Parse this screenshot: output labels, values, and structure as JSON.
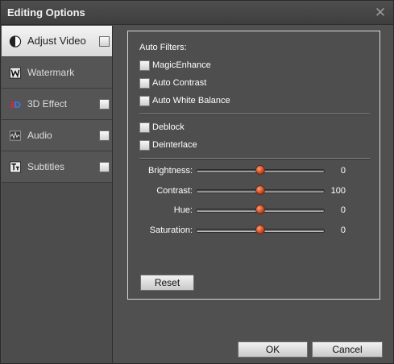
{
  "window": {
    "title": "Editing Options",
    "close_glyph": "✕"
  },
  "sidebar": {
    "items": [
      {
        "label": "Adjust Video",
        "icon": "adjust-video-icon",
        "active": true
      },
      {
        "label": "Watermark",
        "icon": "watermark-icon",
        "active": false
      },
      {
        "label": "3D Effect",
        "icon": "3d-effect-icon",
        "active": false
      },
      {
        "label": "Audio",
        "icon": "audio-icon",
        "active": false
      },
      {
        "label": "Subtitles",
        "icon": "subtitles-icon",
        "active": false
      }
    ]
  },
  "panel": {
    "auto_filters_label": "Auto Filters:",
    "filters": [
      {
        "label": "MagicEnhance",
        "checked": false
      },
      {
        "label": "Auto Contrast",
        "checked": false
      },
      {
        "label": "Auto White Balance",
        "checked": false
      }
    ],
    "processing": [
      {
        "label": "Deblock",
        "checked": false
      },
      {
        "label": "Deinterlace",
        "checked": false
      }
    ],
    "sliders": [
      {
        "label": "Brightness:",
        "value": "0",
        "level": 0.5
      },
      {
        "label": "Contrast:",
        "value": "100",
        "level": 0.5
      },
      {
        "label": "Hue:",
        "value": "0",
        "level": 0.5
      },
      {
        "label": "Saturation:",
        "value": "0",
        "level": 0.5
      }
    ],
    "reset_label": "Reset"
  },
  "footer": {
    "ok_label": "OK",
    "cancel_label": "Cancel"
  },
  "colors": {
    "thumb": "#c7441e",
    "active_tab": "#e6e6e6",
    "window_bg": "#505050"
  }
}
